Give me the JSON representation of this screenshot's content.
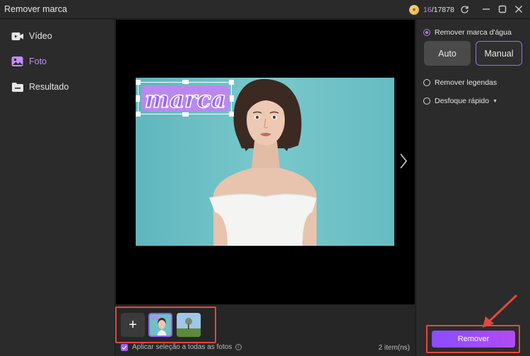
{
  "window": {
    "title": "Remover marca",
    "credits_used": "16",
    "credits_sep": "/",
    "credits_total": "17878"
  },
  "sidebar": {
    "items": [
      {
        "label": "Vídeo",
        "icon": "video-icon",
        "active": false
      },
      {
        "label": "Foto",
        "icon": "photo-icon",
        "active": true
      },
      {
        "label": "Resultado",
        "icon": "folder-icon",
        "active": false
      }
    ]
  },
  "canvas": {
    "watermark_text": "marca"
  },
  "thumbnails": {
    "add_label": "+",
    "apply_label": "Aplicar seleção a todas as fotos",
    "apply_checked": true,
    "count_label": "2 item(ns)"
  },
  "panel": {
    "remove_watermark_label": "Remover marca d'água",
    "auto_label": "Auto",
    "manual_label": "Manual",
    "remove_subtitles_label": "Remover legendas",
    "quick_blur_label": "Desfoque rápido",
    "remove_button_label": "Remover"
  },
  "colors": {
    "accent": "#a05cff",
    "highlight": "#e8463a",
    "watermark_fill": "#b989f0"
  }
}
